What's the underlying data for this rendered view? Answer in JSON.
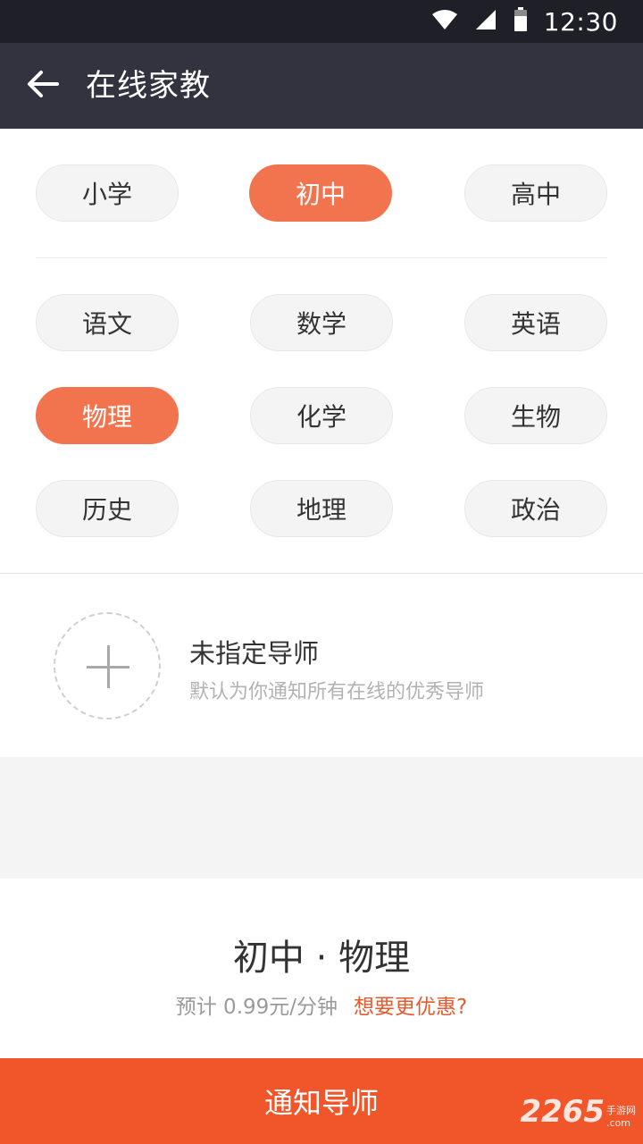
{
  "status_bar": {
    "time": "12:30"
  },
  "app_bar": {
    "title": "在线家教"
  },
  "grade_options": [
    {
      "label": "小学",
      "selected": false
    },
    {
      "label": "初中",
      "selected": true
    },
    {
      "label": "高中",
      "selected": false
    }
  ],
  "subject_options": [
    {
      "label": "语文",
      "selected": false
    },
    {
      "label": "数学",
      "selected": false
    },
    {
      "label": "英语",
      "selected": false
    },
    {
      "label": "物理",
      "selected": true
    },
    {
      "label": "化学",
      "selected": false
    },
    {
      "label": "生物",
      "selected": false
    },
    {
      "label": "历史",
      "selected": false
    },
    {
      "label": "地理",
      "selected": false
    },
    {
      "label": "政治",
      "selected": false
    }
  ],
  "tutor": {
    "title": "未指定导师",
    "subtitle": "默认为你通知所有在线的优秀导师"
  },
  "summary": {
    "title": "初中 · 物理",
    "price": "预计 0.99元/分钟",
    "discount_link": "想要更优惠?"
  },
  "notify_button": {
    "label": "通知导师"
  },
  "watermark": {
    "number": "2265",
    "site_cn": "手游网",
    "site_en": ".com"
  },
  "colors": {
    "accent": "#f2744f",
    "button": "#f0562a",
    "appbar": "#33333f",
    "statusbar": "#1f1f27"
  }
}
